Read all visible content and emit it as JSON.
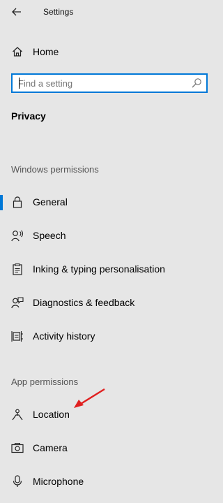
{
  "window": {
    "title": "Settings"
  },
  "nav": {
    "home_label": "Home"
  },
  "search": {
    "placeholder": "Find a setting"
  },
  "page": {
    "title": "Privacy"
  },
  "windows_permissions": {
    "heading": "Windows permissions",
    "items": [
      {
        "label": "General",
        "icon": "lock-icon",
        "active": true
      },
      {
        "label": "Speech",
        "icon": "speech-icon"
      },
      {
        "label": "Inking & typing personalisation",
        "icon": "inking-icon"
      },
      {
        "label": "Diagnostics & feedback",
        "icon": "feedback-icon"
      },
      {
        "label": "Activity history",
        "icon": "activity-history-icon"
      }
    ]
  },
  "app_permissions": {
    "heading": "App permissions",
    "items": [
      {
        "label": "Location",
        "icon": "location-icon"
      },
      {
        "label": "Camera",
        "icon": "camera-icon"
      },
      {
        "label": "Microphone",
        "icon": "microphone-icon"
      }
    ]
  },
  "colors": {
    "accent": "#0078d7",
    "background": "#e6e6e6",
    "annotation_arrow": "#e02020"
  }
}
